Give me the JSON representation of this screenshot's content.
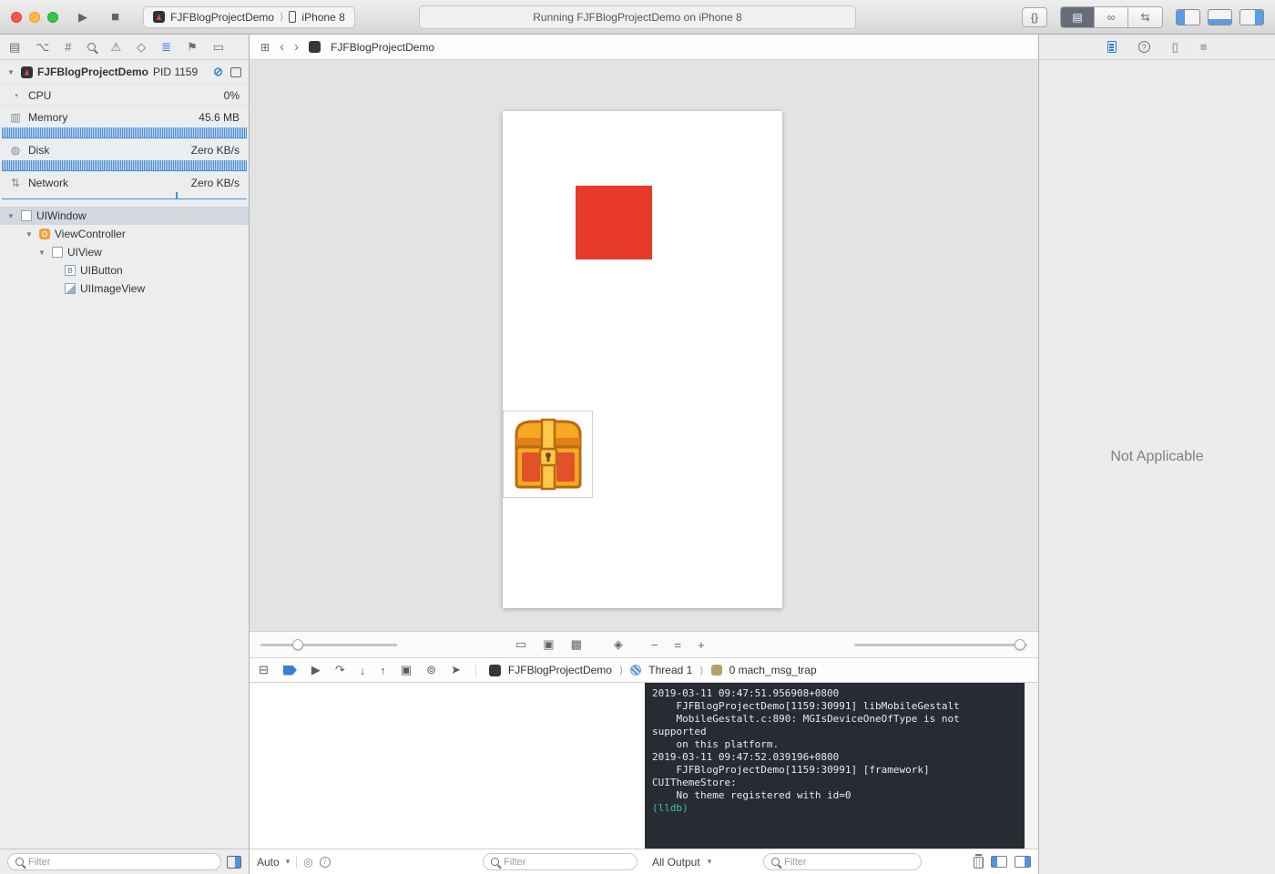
{
  "icons": {
    "play": "▶",
    "stop": "■",
    "snippets": "{}",
    "chevron_sep": "⟩",
    "back": "‹",
    "forward": "›",
    "related": "⊞",
    "editor_standard": "▤",
    "editor_assistant": "∞",
    "editor_version": "⇆",
    "nav_project": "▤",
    "nav_source_control": "⌥",
    "nav_symbol": "#",
    "nav_issue": "⚠",
    "nav_test": "◇",
    "nav_debug": "≣",
    "nav_breakpoint": "⚑",
    "nav_report": "▭",
    "gauge_cpu": "◔",
    "gauge_memory": "▥",
    "gauge_disk": "◍",
    "gauge_network": "⇅",
    "disclosure": "▼",
    "pause_debug": "⊘",
    "button_letter": "B",
    "debug_area": "⊟",
    "continue": "▶",
    "step_over": "↷",
    "step_into": "↓",
    "step_out": "↑",
    "view_hierarchy": "▣",
    "memory_graph": "⊚",
    "location": "➤",
    "view_wire": "▭",
    "view_content": "▣",
    "view_both": "▩",
    "orient": "◈",
    "zoom_out": "−",
    "zoom_actual": "=",
    "zoom_in": "+",
    "scope_var": "◎",
    "info": "i",
    "dropdown": "▾",
    "object_inspector": "▯",
    "size_inspector": "≡"
  },
  "toolbar": {
    "scheme": "FJFBlogProjectDemo",
    "device": "iPhone 8",
    "status": "Running FJFBlogProjectDemo on iPhone 8"
  },
  "navigator": {
    "process_name": "FJFBlogProjectDemo",
    "process_pid": "PID 1159",
    "gauges": [
      {
        "label": "CPU",
        "value": "0%"
      },
      {
        "label": "Memory",
        "value": "45.6 MB"
      },
      {
        "label": "Disk",
        "value": "Zero KB/s"
      },
      {
        "label": "Network",
        "value": "Zero KB/s"
      }
    ],
    "tree": [
      {
        "label": "UIWindow"
      },
      {
        "label": "ViewController"
      },
      {
        "label": "UIView"
      },
      {
        "label": "UIButton"
      },
      {
        "label": "UIImageView"
      }
    ],
    "filter_placeholder": "Filter"
  },
  "jumpbar": {
    "item": "FJFBlogProjectDemo"
  },
  "debugbar": {
    "app": "FJFBlogProjectDemo",
    "thread": "Thread 1",
    "frame": "0 mach_msg_trap"
  },
  "variables": {
    "scope": "Auto",
    "filter_placeholder": "Filter"
  },
  "console": {
    "lines": [
      "2019-03-11 09:47:51.956908+0800",
      "    FJFBlogProjectDemo[1159:30991] libMobileGestalt",
      "    MobileGestalt.c:890: MGIsDeviceOneOfType is not supported",
      "    on this platform.",
      "2019-03-11 09:47:52.039196+0800",
      "    FJFBlogProjectDemo[1159:30991] [framework] CUIThemeStore:",
      "    No theme registered with id=0"
    ],
    "prompt": "(lldb) ",
    "scope": "All Output",
    "filter_placeholder": "Filter"
  },
  "inspector": {
    "empty": "Not Applicable"
  }
}
